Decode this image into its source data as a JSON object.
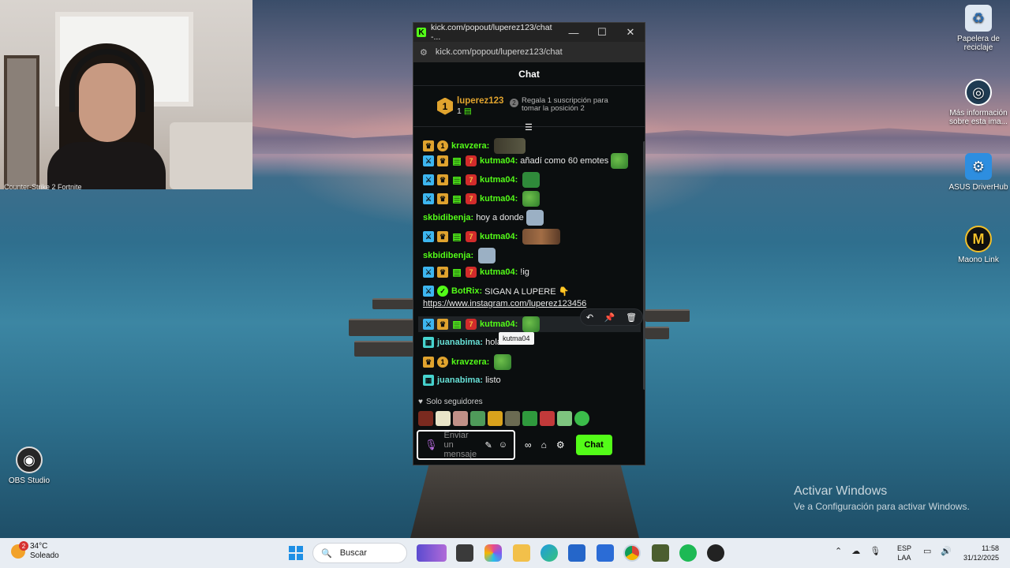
{
  "desktop": {
    "icons": [
      {
        "name": "recycle-bin",
        "label": "Papelera de reciclaje"
      },
      {
        "name": "mas-informacion",
        "label": "Más información sobre esta ima..."
      },
      {
        "name": "asus-driverhub",
        "label": "ASUS DriverHub"
      },
      {
        "name": "maono-link",
        "label": "Maono Link"
      },
      {
        "name": "obs-studio",
        "label": "OBS Studio"
      }
    ],
    "webcam_overlay_text": "Counter-Strike 2       Fortnite",
    "activate_windows": {
      "title": "Activar Windows",
      "subtitle": "Ve a Configuración para activar Windows."
    }
  },
  "popup": {
    "window_title": "kick.com/popout/luperez123/chat -...",
    "url": "kick.com/popout/luperez123/chat",
    "header": "Chat",
    "subscription": {
      "rank": "1",
      "username": "luperez123",
      "count": "1",
      "gift_text": "Regala 1 suscripción para tomar la posición 2"
    },
    "messages": [
      {
        "user": "kravzera:",
        "text": ""
      },
      {
        "user": "kutma04:",
        "text": "añadí como 60 emotes"
      },
      {
        "user": "kutma04:",
        "text": ""
      },
      {
        "user": "kutma04:",
        "text": ""
      },
      {
        "user": "skbidibenja:",
        "text": "hoy a donde"
      },
      {
        "user": "kutma04:",
        "text": ""
      },
      {
        "user": "skbidibenja:",
        "text": ""
      },
      {
        "user": "kutma04:",
        "text": "!ig"
      },
      {
        "user": "BotRix:",
        "text": "SIGAN A LUPERE 👇",
        "link": "https://www.instagram.com/luperez123456"
      },
      {
        "user": "kutma04:",
        "text": ""
      },
      {
        "user": "juanabima:",
        "text": "hola"
      },
      {
        "user": "kravzera:",
        "text": ""
      },
      {
        "user": "juanabima:",
        "text": "listo"
      }
    ],
    "tooltip": "kutma04",
    "followers_only": "Solo seguidores",
    "input_placeholder": "Enviar un mensaje",
    "send_label": "Chat"
  },
  "taskbar": {
    "weather": {
      "temp": "34°C",
      "condition": "Soleado",
      "badge": "2"
    },
    "search_placeholder": "Buscar",
    "language": {
      "line1": "ESP",
      "line2": "LAA"
    },
    "clock": {
      "time": "11:58",
      "date": "31/12/2025"
    }
  },
  "colors": {
    "kick_green": "#53fc18",
    "mod_blue": "#3db6f0",
    "vip_gold": "#e0a32e"
  }
}
